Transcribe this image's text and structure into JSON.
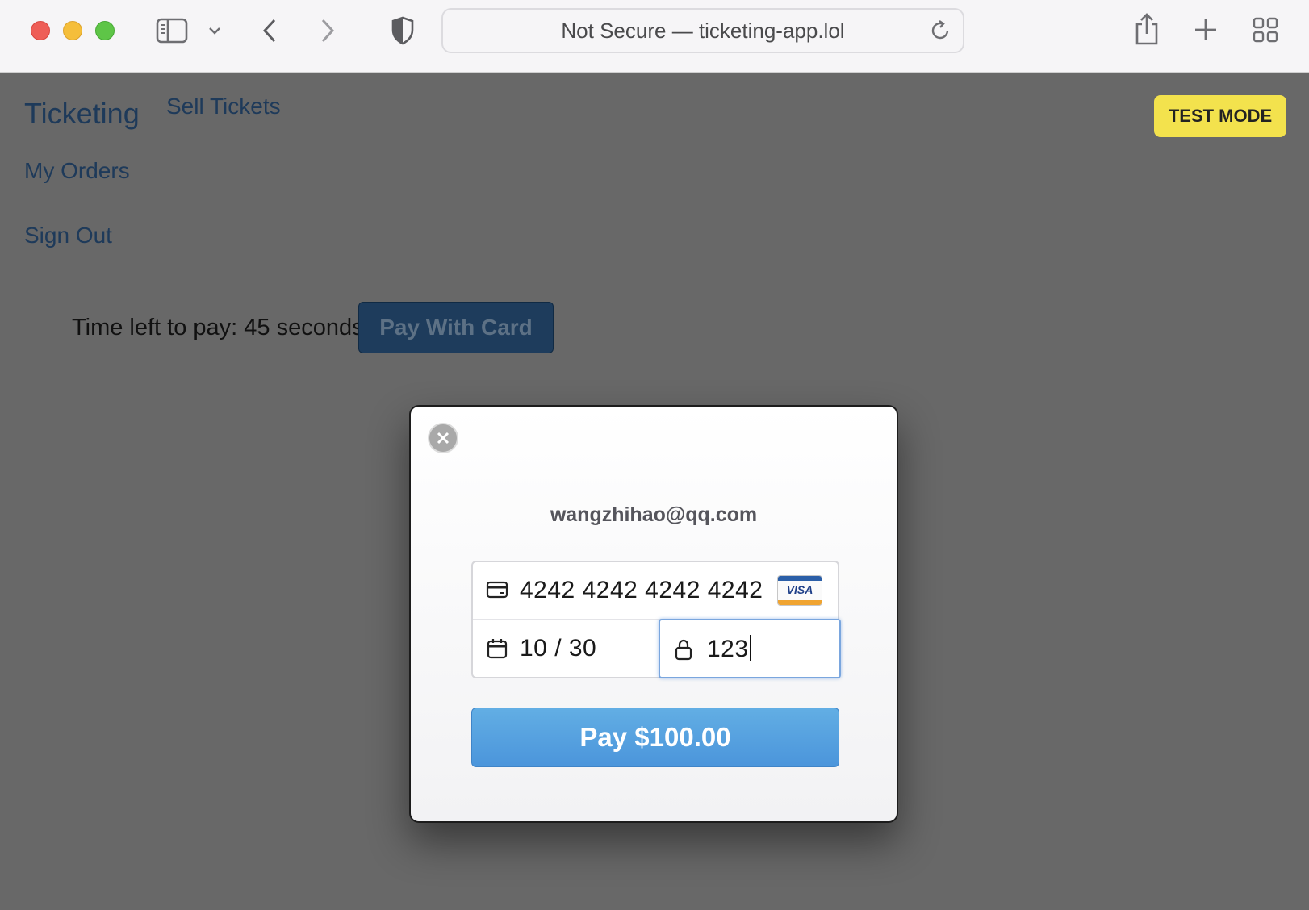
{
  "browser": {
    "url_text": "Not Secure — ticketing-app.lol"
  },
  "nav": {
    "brand": "Ticketing",
    "links": [
      "Sell Tickets",
      "My Orders",
      "Sign Out"
    ]
  },
  "badge": {
    "test_mode": "TEST MODE"
  },
  "main": {
    "time_left": "Time left to pay: 45 seconds",
    "pay_with_card": "Pay With Card"
  },
  "checkout": {
    "email": "wangzhihao@qq.com",
    "card_number": "4242 4242 4242 4242",
    "card_brand": "VISA",
    "expiry": "10 / 30",
    "cvc": "123",
    "pay_button": "Pay $100.00"
  }
}
